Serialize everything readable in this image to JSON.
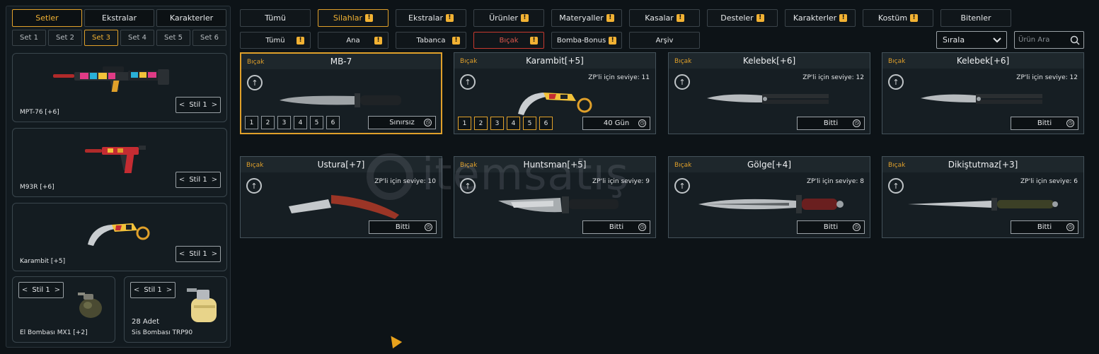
{
  "left_panel": {
    "top_tabs": [
      {
        "label": "Setler",
        "active": true
      },
      {
        "label": "Ekstralar",
        "active": false
      },
      {
        "label": "Karakterler",
        "active": false
      }
    ],
    "set_tabs": [
      {
        "label": "Set 1",
        "active": false
      },
      {
        "label": "Set 2",
        "active": false
      },
      {
        "label": "Set 3",
        "active": true
      },
      {
        "label": "Set 4",
        "active": false
      },
      {
        "label": "Set 5",
        "active": false
      },
      {
        "label": "Set 6",
        "active": false
      }
    ],
    "loadout": {
      "primary": {
        "name": "MPT-76 [+6]",
        "style": "Stil 1"
      },
      "secondary": {
        "name": "M93R [+6]",
        "style": "Stil 1"
      },
      "melee": {
        "name": "Karambit [+5]",
        "style": "Stil 1"
      },
      "grenade": {
        "name": "El Bombası MX1 [+2]",
        "style": "Stil 1"
      },
      "smoke": {
        "name": "Sis Bombası TRP90",
        "count": "28 Adet",
        "style": "Stil 1"
      }
    }
  },
  "filters": {
    "categories": [
      {
        "label": "Tümü",
        "warn": false,
        "active": false
      },
      {
        "label": "Silahlar",
        "warn": true,
        "active": true
      },
      {
        "label": "Ekstralar",
        "warn": true,
        "active": false
      },
      {
        "label": "Ürünler",
        "warn": true,
        "active": false
      },
      {
        "label": "Materyaller",
        "warn": true,
        "active": false
      },
      {
        "label": "Kasalar",
        "warn": true,
        "active": false
      },
      {
        "label": "Desteler",
        "warn": true,
        "active": false
      },
      {
        "label": "Karakterler",
        "warn": true,
        "active": false
      },
      {
        "label": "Kostüm",
        "warn": true,
        "active": false
      },
      {
        "label": "Bitenler",
        "warn": false,
        "active": false
      }
    ],
    "subcategories": [
      {
        "label": "Tümü",
        "warn": true,
        "state": "normal"
      },
      {
        "label": "Ana",
        "warn": true,
        "state": "normal"
      },
      {
        "label": "Tabanca",
        "warn": true,
        "state": "normal"
      },
      {
        "label": "Bıçak",
        "warn": true,
        "state": "red"
      },
      {
        "label": "Bomba-Bonus",
        "warn": true,
        "state": "normal"
      },
      {
        "label": "Arşiv",
        "warn": false,
        "state": "normal"
      }
    ],
    "warn_glyph": "!",
    "sort_label": "Sırala",
    "search_placeholder": "Ürün Ara"
  },
  "items": [
    {
      "type": "Bıçak",
      "title": "MB-7",
      "level_text": "",
      "status": "Sınırsız",
      "levels": [
        "1",
        "2",
        "3",
        "4",
        "5",
        "6"
      ],
      "levels_gold": false,
      "selected": true
    },
    {
      "type": "Bıçak",
      "title": "Karambit[+5]",
      "level_text": "ZP'li için seviye: 11",
      "status": "40 Gün",
      "levels": [
        "1",
        "2",
        "3",
        "4",
        "5",
        "6"
      ],
      "levels_gold": true,
      "selected": false
    },
    {
      "type": "Bıçak",
      "title": "Kelebek[+6]",
      "level_text": "ZP'li için seviye: 12",
      "status": "Bitti",
      "levels": [],
      "levels_gold": false,
      "selected": false
    },
    {
      "type": "Bıçak",
      "title": "Kelebek[+6]",
      "level_text": "ZP'li için seviye: 12",
      "status": "Bitti",
      "levels": [],
      "levels_gold": false,
      "selected": false
    },
    {
      "type": "Bıçak",
      "title": "Ustura[+7]",
      "level_text": "ZP'li için seviye: 10",
      "status": "Bitti",
      "levels": [],
      "levels_gold": false,
      "selected": false
    },
    {
      "type": "Bıçak",
      "title": "Huntsman[+5]",
      "level_text": "ZP'li için seviye: 9",
      "status": "Bitti",
      "levels": [],
      "levels_gold": false,
      "selected": false
    },
    {
      "type": "Bıçak",
      "title": "Gölge[+4]",
      "level_text": "ZP'li için seviye: 8",
      "status": "Bitti",
      "levels": [],
      "levels_gold": false,
      "selected": false
    },
    {
      "type": "Bıçak",
      "title": "Dikiştutmaz[+3]",
      "level_text": "ZP'li için seviye: 6",
      "status": "Bitti",
      "levels": [],
      "levels_gold": false,
      "selected": false
    }
  ],
  "watermark": "itemsatış",
  "colors": {
    "accent": "#e0a02a",
    "red": "#c63a2f",
    "bg": "#0d1317"
  }
}
